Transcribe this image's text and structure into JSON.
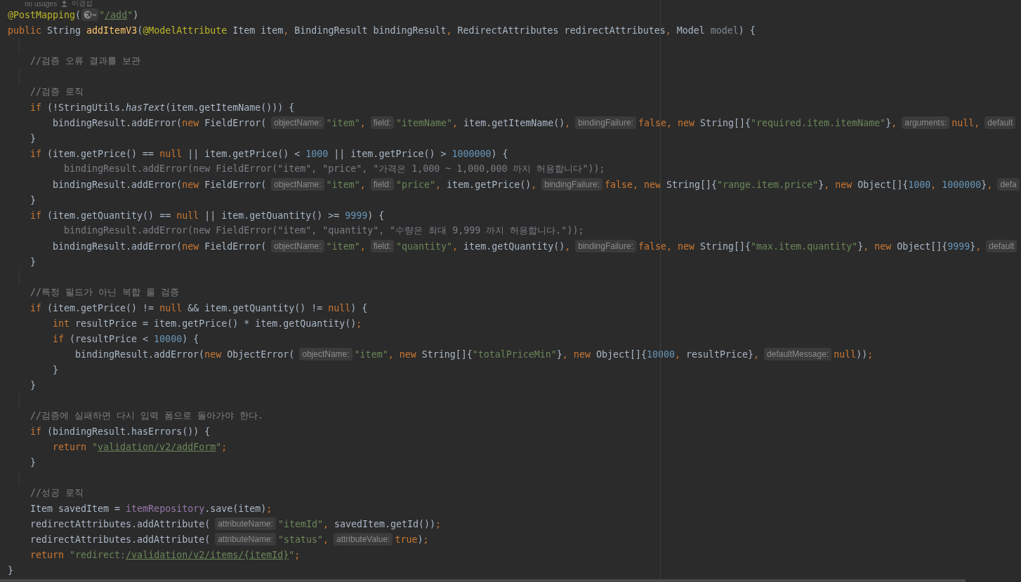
{
  "header": {
    "usages": "no usages",
    "author": "이경섭"
  },
  "lines": [
    {
      "parts": [
        {
          "kind": "code",
          "tokens": [
            {
              "text": "@PostMapping",
              "kind": "annot"
            },
            {
              "text": "(",
              "kind": "plain"
            }
          ]
        },
        {
          "kind": "icon"
        },
        {
          "kind": "code",
          "tokens": [
            {
              "text": "\"",
              "kind": "str"
            },
            {
              "text": "/add",
              "kind": "link"
            },
            {
              "text": "\"",
              "kind": "str"
            },
            {
              "text": ")",
              "kind": "plain"
            }
          ]
        }
      ]
    },
    {
      "parts": [
        {
          "kind": "code",
          "tokens": [
            {
              "text": "public",
              "kind": "kw"
            },
            {
              "text": " String ",
              "kind": "plain"
            },
            {
              "text": "addItemV3",
              "kind": "decl"
            },
            {
              "text": "(",
              "kind": "plain"
            },
            {
              "text": "@ModelAttribute",
              "kind": "annot"
            },
            {
              "text": " Item item",
              "kind": "plain"
            },
            {
              "text": ",",
              "kind": "kw"
            },
            {
              "text": " BindingResult bindingResult",
              "kind": "plain"
            },
            {
              "text": ",",
              "kind": "kw"
            },
            {
              "text": " RedirectAttributes redirectAttributes",
              "kind": "plain"
            },
            {
              "text": ",",
              "kind": "kw"
            },
            {
              "text": " Model ",
              "kind": "plain"
            },
            {
              "text": "model",
              "kind": "unused"
            },
            {
              "text": ") {",
              "kind": "plain"
            }
          ]
        }
      ]
    },
    {
      "kind": "blank"
    },
    {
      "parts": [
        {
          "kind": "code",
          "tokens": [
            {
              "text": "    //검증 오류 결과를 보관",
              "kind": "comment"
            }
          ]
        }
      ]
    },
    {
      "kind": "blank"
    },
    {
      "parts": [
        {
          "kind": "code",
          "tokens": [
            {
              "text": "    //검증 로직",
              "kind": "comment"
            }
          ]
        }
      ]
    },
    {
      "parts": [
        {
          "kind": "code",
          "tokens": [
            {
              "text": "    if",
              "kind": "kw"
            },
            {
              "text": " (!StringUtils.",
              "kind": "plain"
            },
            {
              "text": "hasText",
              "kind": "italic"
            },
            {
              "text": "(item.getItemName())) {",
              "kind": "plain"
            }
          ]
        }
      ]
    },
    {
      "parts": [
        {
          "kind": "code",
          "tokens": [
            {
              "text": "        bindingResult.addError(",
              "kind": "plain"
            },
            {
              "text": "new",
              "kind": "kw"
            },
            {
              "text": " FieldError(",
              "kind": "plain"
            }
          ]
        },
        {
          "kind": "hint",
          "text": "objectName:"
        },
        {
          "kind": "code",
          "tokens": [
            {
              "text": "\"item\"",
              "kind": "str"
            },
            {
              "text": ",",
              "kind": "kw"
            }
          ]
        },
        {
          "kind": "hint",
          "text": "field:"
        },
        {
          "kind": "code",
          "tokens": [
            {
              "text": "\"itemName\"",
              "kind": "str"
            },
            {
              "text": ",",
              "kind": "kw"
            },
            {
              "text": " item.getItemName()",
              "kind": "plain"
            },
            {
              "text": ",",
              "kind": "kw"
            }
          ]
        },
        {
          "kind": "hint",
          "text": "bindingFailure:"
        },
        {
          "kind": "code",
          "tokens": [
            {
              "text": "false",
              "kind": "kw"
            },
            {
              "text": ", new",
              "kind": "kw"
            },
            {
              "text": " String[]{",
              "kind": "plain"
            },
            {
              "text": "\"required.item.itemName\"",
              "kind": "str"
            },
            {
              "text": "}",
              "kind": "plain"
            },
            {
              "text": ",",
              "kind": "kw"
            }
          ]
        },
        {
          "kind": "hint",
          "text": "arguments:"
        },
        {
          "kind": "code",
          "tokens": [
            {
              "text": "null",
              "kind": "kw"
            },
            {
              "text": ",",
              "kind": "kw"
            }
          ]
        },
        {
          "kind": "hint",
          "text": "default"
        }
      ]
    },
    {
      "parts": [
        {
          "kind": "code",
          "tokens": [
            {
              "text": "    }",
              "kind": "plain"
            }
          ]
        }
      ]
    },
    {
      "parts": [
        {
          "kind": "code",
          "tokens": [
            {
              "text": "    if",
              "kind": "kw"
            },
            {
              "text": " (item.getPrice() == ",
              "kind": "plain"
            },
            {
              "text": "null",
              "kind": "kw"
            },
            {
              "text": " || item.getPrice() < ",
              "kind": "plain"
            },
            {
              "text": "1000",
              "kind": "num"
            },
            {
              "text": " || item.getPrice() > ",
              "kind": "plain"
            },
            {
              "text": "1000000",
              "kind": "num"
            },
            {
              "text": ") {",
              "kind": "plain"
            }
          ]
        }
      ]
    },
    {
      "parts": [
        {
          "kind": "code",
          "tokens": [
            {
              "text": "          bindingResult.addError(new FieldError(\"item\", \"price\", \"가격은 1,000 ~ 1,000,000 까지 허용합니다\"));",
              "kind": "dim"
            }
          ]
        }
      ]
    },
    {
      "parts": [
        {
          "kind": "code",
          "tokens": [
            {
              "text": "        bindingResult.addError(",
              "kind": "plain"
            },
            {
              "text": "new",
              "kind": "kw"
            },
            {
              "text": " FieldError(",
              "kind": "plain"
            }
          ]
        },
        {
          "kind": "hint",
          "text": "objectName:"
        },
        {
          "kind": "code",
          "tokens": [
            {
              "text": "\"item\"",
              "kind": "str"
            },
            {
              "text": ",",
              "kind": "kw"
            }
          ]
        },
        {
          "kind": "hint",
          "text": "field:"
        },
        {
          "kind": "code",
          "tokens": [
            {
              "text": "\"price\"",
              "kind": "str"
            },
            {
              "text": ",",
              "kind": "kw"
            },
            {
              "text": " item.getPrice()",
              "kind": "plain"
            },
            {
              "text": ",",
              "kind": "kw"
            }
          ]
        },
        {
          "kind": "hint",
          "text": "bindingFailure:"
        },
        {
          "kind": "code",
          "tokens": [
            {
              "text": "false",
              "kind": "kw"
            },
            {
              "text": ", new",
              "kind": "kw"
            },
            {
              "text": " String[]{",
              "kind": "plain"
            },
            {
              "text": "\"range.item.price\"",
              "kind": "str"
            },
            {
              "text": "}",
              "kind": "plain"
            },
            {
              "text": ", new",
              "kind": "kw"
            },
            {
              "text": " Object[]{",
              "kind": "plain"
            },
            {
              "text": "1000",
              "kind": "num"
            },
            {
              "text": ", ",
              "kind": "kw"
            },
            {
              "text": "1000000",
              "kind": "num"
            },
            {
              "text": "}",
              "kind": "plain"
            },
            {
              "text": ",",
              "kind": "kw"
            }
          ]
        },
        {
          "kind": "hint",
          "text": "defa"
        }
      ]
    },
    {
      "parts": [
        {
          "kind": "code",
          "tokens": [
            {
              "text": "    }",
              "kind": "plain"
            }
          ]
        }
      ]
    },
    {
      "parts": [
        {
          "kind": "code",
          "tokens": [
            {
              "text": "    if",
              "kind": "kw"
            },
            {
              "text": " (item.getQuantity() == ",
              "kind": "plain"
            },
            {
              "text": "null",
              "kind": "kw"
            },
            {
              "text": " || item.getQuantity() >= ",
              "kind": "plain"
            },
            {
              "text": "9999",
              "kind": "num"
            },
            {
              "text": ") {",
              "kind": "plain"
            }
          ]
        }
      ]
    },
    {
      "parts": [
        {
          "kind": "code",
          "tokens": [
            {
              "text": "          bindingResult.addError(new FieldError(\"item\", \"quantity\", \"수량은 최대 9,999 까지 허용합니다.\"));",
              "kind": "dim"
            }
          ]
        }
      ]
    },
    {
      "parts": [
        {
          "kind": "code",
          "tokens": [
            {
              "text": "        bindingResult.addError(",
              "kind": "plain"
            },
            {
              "text": "new",
              "kind": "kw"
            },
            {
              "text": " FieldError(",
              "kind": "plain"
            }
          ]
        },
        {
          "kind": "hint",
          "text": "objectName:"
        },
        {
          "kind": "code",
          "tokens": [
            {
              "text": "\"item\"",
              "kind": "str"
            },
            {
              "text": ",",
              "kind": "kw"
            }
          ]
        },
        {
          "kind": "hint",
          "text": "field:"
        },
        {
          "kind": "code",
          "tokens": [
            {
              "text": "\"quantity\"",
              "kind": "str"
            },
            {
              "text": ",",
              "kind": "kw"
            },
            {
              "text": " item.getQuantity()",
              "kind": "plain"
            },
            {
              "text": ",",
              "kind": "kw"
            }
          ]
        },
        {
          "kind": "hint",
          "text": "bindingFailure:"
        },
        {
          "kind": "code",
          "tokens": [
            {
              "text": "false",
              "kind": "kw"
            },
            {
              "text": ", new",
              "kind": "kw"
            },
            {
              "text": " String[]{",
              "kind": "plain"
            },
            {
              "text": "\"max.item.quantity\"",
              "kind": "str"
            },
            {
              "text": "}",
              "kind": "plain"
            },
            {
              "text": ", new",
              "kind": "kw"
            },
            {
              "text": " Object[]{",
              "kind": "plain"
            },
            {
              "text": "9999",
              "kind": "num"
            },
            {
              "text": "}",
              "kind": "plain"
            },
            {
              "text": ",",
              "kind": "kw"
            }
          ]
        },
        {
          "kind": "hint",
          "text": "default"
        }
      ]
    },
    {
      "parts": [
        {
          "kind": "code",
          "tokens": [
            {
              "text": "    }",
              "kind": "plain"
            }
          ]
        }
      ]
    },
    {
      "kind": "blank"
    },
    {
      "parts": [
        {
          "kind": "code",
          "tokens": [
            {
              "text": "    //특정 필드가 아닌 복합 룰 검증",
              "kind": "comment"
            }
          ]
        }
      ]
    },
    {
      "parts": [
        {
          "kind": "code",
          "tokens": [
            {
              "text": "    if",
              "kind": "kw"
            },
            {
              "text": " (item.getPrice() != ",
              "kind": "plain"
            },
            {
              "text": "null",
              "kind": "kw"
            },
            {
              "text": " && item.getQuantity() != ",
              "kind": "plain"
            },
            {
              "text": "null",
              "kind": "kw"
            },
            {
              "text": ") {",
              "kind": "plain"
            }
          ]
        }
      ]
    },
    {
      "parts": [
        {
          "kind": "code",
          "tokens": [
            {
              "text": "        int",
              "kind": "kw"
            },
            {
              "text": " resultPrice = item.getPrice() * item.getQuantity()",
              "kind": "plain"
            },
            {
              "text": ";",
              "kind": "kw"
            }
          ]
        }
      ]
    },
    {
      "parts": [
        {
          "kind": "code",
          "tokens": [
            {
              "text": "        if",
              "kind": "kw"
            },
            {
              "text": " (resultPrice < ",
              "kind": "plain"
            },
            {
              "text": "10000",
              "kind": "num"
            },
            {
              "text": ") {",
              "kind": "plain"
            }
          ]
        }
      ]
    },
    {
      "parts": [
        {
          "kind": "code",
          "tokens": [
            {
              "text": "            bindingResult.addError(",
              "kind": "plain"
            },
            {
              "text": "new",
              "kind": "kw"
            },
            {
              "text": " ObjectError(",
              "kind": "plain"
            }
          ]
        },
        {
          "kind": "hint",
          "text": "objectName:"
        },
        {
          "kind": "code",
          "tokens": [
            {
              "text": "\"item\"",
              "kind": "str"
            },
            {
              "text": ", new",
              "kind": "kw"
            },
            {
              "text": " String[]{",
              "kind": "plain"
            },
            {
              "text": "\"totalPriceMin\"",
              "kind": "str"
            },
            {
              "text": "}",
              "kind": "plain"
            },
            {
              "text": ", new",
              "kind": "kw"
            },
            {
              "text": " Object[]{",
              "kind": "plain"
            },
            {
              "text": "10000",
              "kind": "num"
            },
            {
              "text": ",",
              "kind": "kw"
            },
            {
              "text": " resultPrice}",
              "kind": "plain"
            },
            {
              "text": ",",
              "kind": "kw"
            }
          ]
        },
        {
          "kind": "hint",
          "text": "defaultMessage:"
        },
        {
          "kind": "code",
          "tokens": [
            {
              "text": "null",
              "kind": "kw"
            },
            {
              "text": "))",
              "kind": "plain"
            },
            {
              "text": ";",
              "kind": "kw"
            }
          ]
        }
      ]
    },
    {
      "parts": [
        {
          "kind": "code",
          "tokens": [
            {
              "text": "        }",
              "kind": "plain"
            }
          ]
        }
      ]
    },
    {
      "parts": [
        {
          "kind": "code",
          "tokens": [
            {
              "text": "    }",
              "kind": "plain"
            }
          ]
        }
      ]
    },
    {
      "kind": "blank"
    },
    {
      "parts": [
        {
          "kind": "code",
          "tokens": [
            {
              "text": "    //검증에 실패하면 다시 입력 폼으로 돌아가야 한다.",
              "kind": "comment"
            }
          ]
        }
      ]
    },
    {
      "parts": [
        {
          "kind": "code",
          "tokens": [
            {
              "text": "    if",
              "kind": "kw"
            },
            {
              "text": " (bindingResult.hasErrors()) {",
              "kind": "plain"
            }
          ]
        }
      ]
    },
    {
      "parts": [
        {
          "kind": "code",
          "tokens": [
            {
              "text": "        return",
              "kind": "kw"
            },
            {
              "text": " \"",
              "kind": "str"
            },
            {
              "text": "validation/v2/addForm",
              "kind": "link"
            },
            {
              "text": "\"",
              "kind": "str"
            },
            {
              "text": ";",
              "kind": "kw"
            }
          ]
        }
      ]
    },
    {
      "parts": [
        {
          "kind": "code",
          "tokens": [
            {
              "text": "    }",
              "kind": "plain"
            }
          ]
        }
      ]
    },
    {
      "kind": "blank"
    },
    {
      "parts": [
        {
          "kind": "code",
          "tokens": [
            {
              "text": "    //성공 로직",
              "kind": "comment"
            }
          ]
        }
      ]
    },
    {
      "parts": [
        {
          "kind": "code",
          "tokens": [
            {
              "text": "    Item savedItem = ",
              "kind": "plain"
            },
            {
              "text": "itemRepository",
              "kind": "field"
            },
            {
              "text": ".save(item)",
              "kind": "plain"
            },
            {
              "text": ";",
              "kind": "kw"
            }
          ]
        }
      ]
    },
    {
      "parts": [
        {
          "kind": "code",
          "tokens": [
            {
              "text": "    redirectAttributes.addAttribute(",
              "kind": "plain"
            }
          ]
        },
        {
          "kind": "hint",
          "text": "attributeName:"
        },
        {
          "kind": "code",
          "tokens": [
            {
              "text": "\"itemId\"",
              "kind": "str"
            },
            {
              "text": ",",
              "kind": "kw"
            },
            {
              "text": " savedItem.getId())",
              "kind": "plain"
            },
            {
              "text": ";",
              "kind": "kw"
            }
          ]
        }
      ]
    },
    {
      "parts": [
        {
          "kind": "code",
          "tokens": [
            {
              "text": "    redirectAttributes.addAttribute(",
              "kind": "plain"
            }
          ]
        },
        {
          "kind": "hint",
          "text": "attributeName:"
        },
        {
          "kind": "code",
          "tokens": [
            {
              "text": "\"status\"",
              "kind": "str"
            },
            {
              "text": ",",
              "kind": "kw"
            }
          ]
        },
        {
          "kind": "hint",
          "text": "attributeValue:"
        },
        {
          "kind": "code",
          "tokens": [
            {
              "text": "true",
              "kind": "kw"
            },
            {
              "text": ")",
              "kind": "plain"
            },
            {
              "text": ";",
              "kind": "kw"
            }
          ]
        }
      ]
    },
    {
      "parts": [
        {
          "kind": "code",
          "tokens": [
            {
              "text": "    return",
              "kind": "kw"
            },
            {
              "text": " \"redirect:",
              "kind": "str"
            },
            {
              "text": "/validation/v2/items/{itemId}",
              "kind": "link"
            },
            {
              "text": "\"",
              "kind": "str"
            },
            {
              "text": ";",
              "kind": "kw"
            }
          ]
        }
      ]
    },
    {
      "parts": [
        {
          "kind": "code",
          "tokens": [
            {
              "text": "}",
              "kind": "plain"
            }
          ]
        }
      ]
    }
  ]
}
